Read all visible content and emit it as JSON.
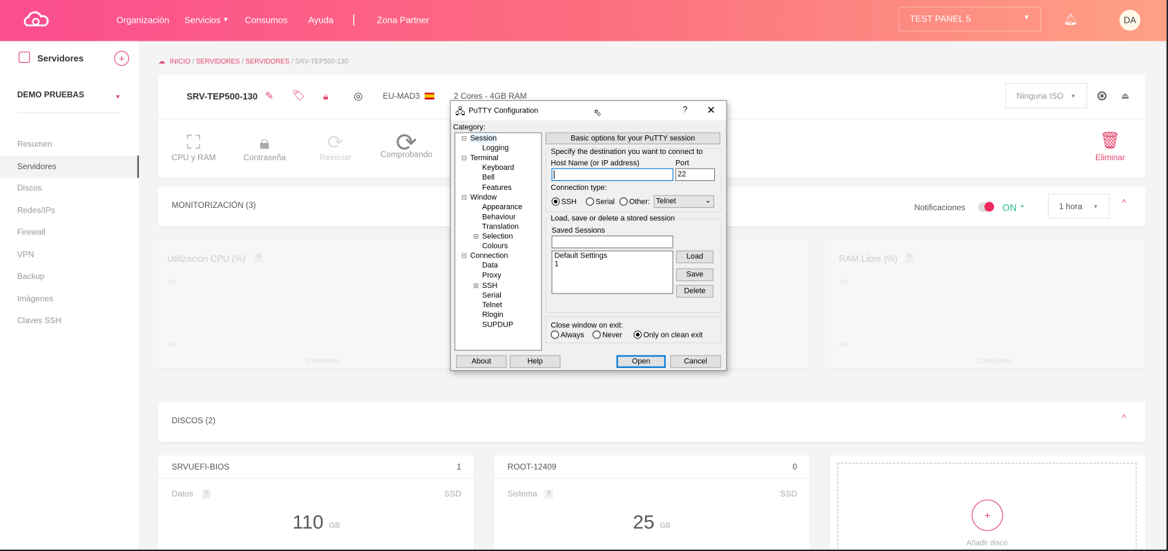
{
  "topbar": {
    "nav": [
      "Organización",
      "Servicios",
      "Consumos",
      "Ayuda",
      "Zona Partner"
    ],
    "panel": "TEST PANEL 5",
    "avatar": "DA"
  },
  "sidebar": {
    "title": "Servidores",
    "project": "DEMO PRUEBAS",
    "items": [
      "Resumen",
      "Servidores",
      "Discos",
      "Redes/IPs",
      "Firewall",
      "VPN",
      "Backup",
      "Imágenes",
      "Claves SSH"
    ]
  },
  "breadcrumb": [
    "INICIO",
    "SERVIDORES",
    "SERVIDORES",
    "SRV-TEP500-130"
  ],
  "server": {
    "name": "SRV-TEP500-130",
    "region": "EU-MAD3",
    "specs": "2 Cores - 4GB RAM",
    "iso": "Ninguna ISO"
  },
  "tools": [
    "CPU y RAM",
    "Contraseña",
    "Reiniciar",
    "Comprobando"
  ],
  "delete_label": "Eliminar",
  "monitor": {
    "title": "MONITORIZACIÓN (3)",
    "notif_label": "Notificaciones",
    "notif_state": "ON",
    "range": "1 hora",
    "charts": [
      {
        "title": "Utilización CPU (%)",
        "ymax": "1%",
        "ymin": "0%",
        "x": "11:00:00.000"
      },
      {
        "title": "RAM Libre (%)",
        "ymax": "1%",
        "ymin": "0%",
        "x": "11:00:00.000"
      }
    ]
  },
  "disks": {
    "title": "DISCOS (2)",
    "items": [
      {
        "name": "SRVUEFI-BIOS",
        "count": "1",
        "type": "Datos",
        "media": "SSD",
        "size": "110",
        "unit": "GB"
      },
      {
        "name": "ROOT-12409",
        "count": "0",
        "type": "Sistema",
        "media": "SSD",
        "size": "25",
        "unit": "GB"
      }
    ],
    "add": "Añadir disco"
  },
  "putty": {
    "title": "PuTTY Configuration",
    "help": "?",
    "category": "Category:",
    "tree": [
      "Session",
      "Logging",
      "Terminal",
      "Keyboard",
      "Bell",
      "Features",
      "Window",
      "Appearance",
      "Behaviour",
      "Translation",
      "Selection",
      "Colours",
      "Connection",
      "Data",
      "Proxy",
      "SSH",
      "Serial",
      "Telnet",
      "Rlogin",
      "SUPDUP"
    ],
    "header": "Basic options for your PuTTY session",
    "dest": "Specify the destination you want to connect to",
    "host_label": "Host Name (or IP address)",
    "host": "",
    "port_label": "Port",
    "port": "22",
    "conn_label": "Connection type:",
    "conn": [
      "SSH",
      "Serial",
      "Other:"
    ],
    "other_value": "Telnet",
    "sess_group": "Load, save or delete a stored session",
    "saved_label": "Saved Sessions",
    "saved": "",
    "sessions": [
      "Default Settings",
      "1"
    ],
    "load": "Load",
    "save": "Save",
    "delete": "Delete",
    "close_label": "Close window on exit:",
    "close_opts": [
      "Always",
      "Never",
      "Only on clean exit"
    ],
    "about": "About",
    "helpbtn": "Help",
    "open": "Open",
    "cancel": "Cancel"
  }
}
